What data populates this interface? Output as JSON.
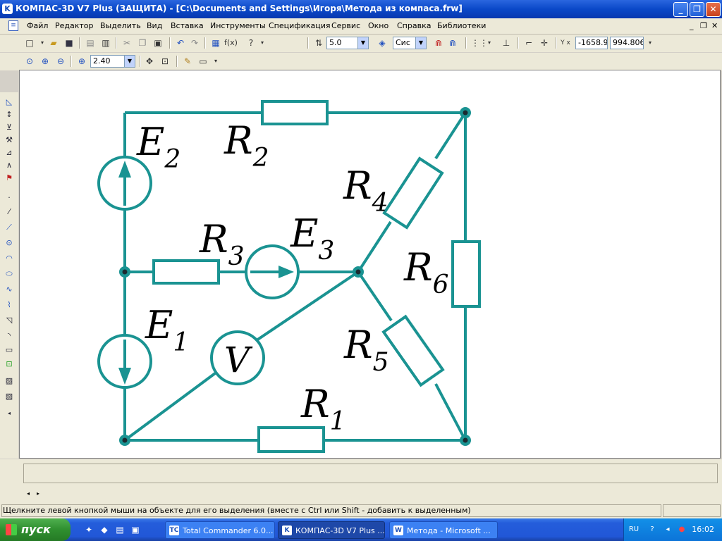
{
  "window": {
    "title": "КОМПАС-3D V7 Plus (ЗАЩИТА) - [C:\\Documents and Settings\\Игоря\\Метода из компаса.frw]",
    "app_icon": "K",
    "controls": {
      "minimize": "_",
      "restore": "❐",
      "close": "✕"
    }
  },
  "menu": {
    "doc_icon": "≡",
    "items": [
      "Файл",
      "Редактор",
      "Выделить",
      "Вид",
      "Вставка",
      "Инструменты",
      "Спецификация",
      "Сервис",
      "Окно",
      "Справка",
      "Библиотеки"
    ],
    "mdi_controls": {
      "minimize": "_",
      "restore": "❐",
      "close": "✕"
    }
  },
  "toolbar1": {
    "step_value": "5.0",
    "layer_value": "Сис",
    "coord_x": "-1658.9",
    "coord_y": "994.806"
  },
  "toolbar2": {
    "zoom_value": "2.40"
  },
  "circuit": {
    "accent_color": "#1a9392",
    "labels": {
      "E2": {
        "letter": "E",
        "sub": "2"
      },
      "R2": {
        "letter": "R",
        "sub": "2"
      },
      "R4": {
        "letter": "R",
        "sub": "4"
      },
      "R3": {
        "letter": "R",
        "sub": "3"
      },
      "E3": {
        "letter": "E",
        "sub": "3"
      },
      "R6": {
        "letter": "R",
        "sub": "6"
      },
      "E1": {
        "letter": "E",
        "sub": "1"
      },
      "R5": {
        "letter": "R",
        "sub": "5"
      },
      "V": {
        "letter": "V"
      },
      "R1": {
        "letter": "R",
        "sub": "1"
      }
    }
  },
  "status": {
    "hint": "Щелкните левой кнопкой мыши на объекте для его выделения (вместе с Ctrl или Shift - добавить к выделенным)"
  },
  "taskbar": {
    "start_label": "пуск",
    "tasks": [
      {
        "label": "Total Commander 6.0...",
        "icon": "TC",
        "active": false
      },
      {
        "label": "КОМПАС-3D V7 Plus ...",
        "icon": "K",
        "active": true
      },
      {
        "label": "Метода - Microsoft ...",
        "icon": "W",
        "active": false
      }
    ],
    "lang": "RU",
    "clock": "16:02"
  }
}
